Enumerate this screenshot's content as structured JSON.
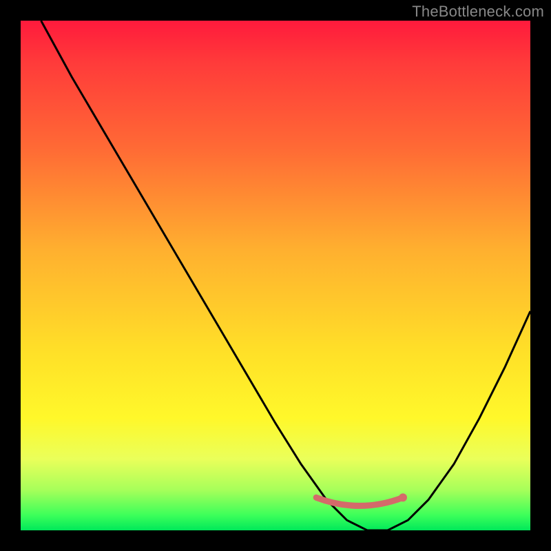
{
  "watermark": "TheBottleneck.com",
  "colors": {
    "background": "#000000",
    "gradient_top": "#ff1a3c",
    "gradient_mid": "#ffe028",
    "gradient_bottom": "#00e85a",
    "curve": "#000000",
    "optimal_marker": "#d46a6a"
  },
  "chart_data": {
    "type": "line",
    "title": "",
    "xlabel": "",
    "ylabel": "",
    "xlim": [
      0,
      100
    ],
    "ylim": [
      0,
      100
    ],
    "series": [
      {
        "name": "bottleneck-curve",
        "x": [
          4,
          10,
          20,
          30,
          40,
          50,
          55,
          60,
          64,
          68,
          72,
          76,
          80,
          85,
          90,
          95,
          100
        ],
        "values": [
          100,
          89,
          72,
          55,
          38,
          21,
          13,
          6,
          2,
          0,
          0,
          2,
          6,
          13,
          22,
          32,
          43
        ]
      }
    ],
    "optimal_range": {
      "x_start": 58,
      "x_end": 75,
      "y": 4
    }
  }
}
